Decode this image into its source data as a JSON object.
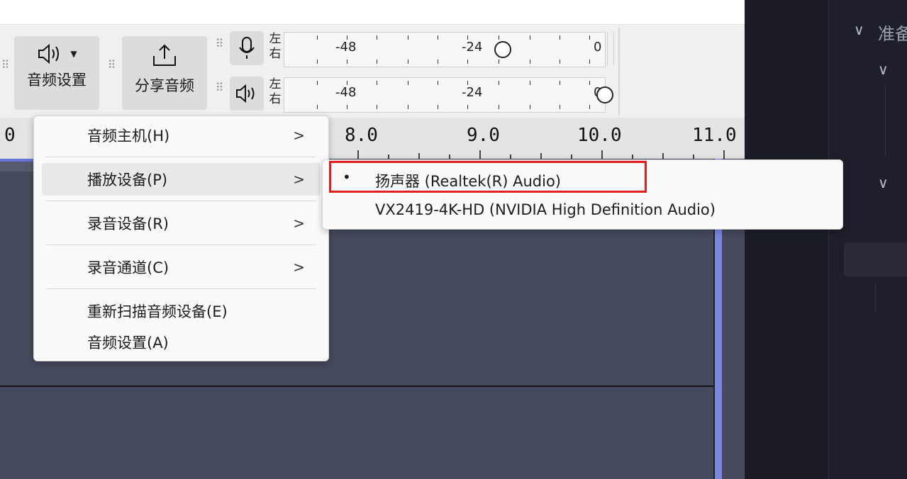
{
  "toolbar": {
    "audio_settings_label": "音频设置",
    "share_audio_label": "分享音频",
    "record_meter": {
      "left_label": "左",
      "right_label": "右",
      "ticks": [
        "-48",
        "-24",
        "0"
      ]
    },
    "playback_meter": {
      "left_label": "左",
      "right_label": "右",
      "ticks": [
        "-48",
        "-24",
        "0"
      ]
    }
  },
  "ruler": {
    "labels": [
      "0",
      "8.0",
      "9.0",
      "10.0",
      "11.0"
    ]
  },
  "audio_setup_menu": {
    "items": [
      {
        "label": "音频主机(H)",
        "submenu": true
      },
      {
        "label": "播放设备(P)",
        "submenu": true,
        "active": true
      },
      {
        "label": "录音设备(R)",
        "submenu": true
      },
      {
        "label": "录音通道(C)",
        "submenu": true
      },
      {
        "label": "重新扫描音频设备(E)",
        "submenu": false
      },
      {
        "label": "音频设置(A)",
        "submenu": false
      }
    ],
    "arrow_glyph": ">"
  },
  "playback_device_submenu": {
    "items": [
      {
        "label": "扬声器 (Realtek(R) Audio)",
        "selected": true
      },
      {
        "label": "VX2419-4K-HD (NVIDIA High Definition Audio)",
        "selected": false
      }
    ],
    "bullet_glyph": "•"
  },
  "right_panel": {
    "items": [
      {
        "text": "准备"
      }
    ]
  },
  "colors": {
    "highlight_border": "#e02020",
    "track_bg": "#464a5e",
    "playhead": "#7b86e0",
    "right_panel_bg": "#1e1f2a"
  }
}
